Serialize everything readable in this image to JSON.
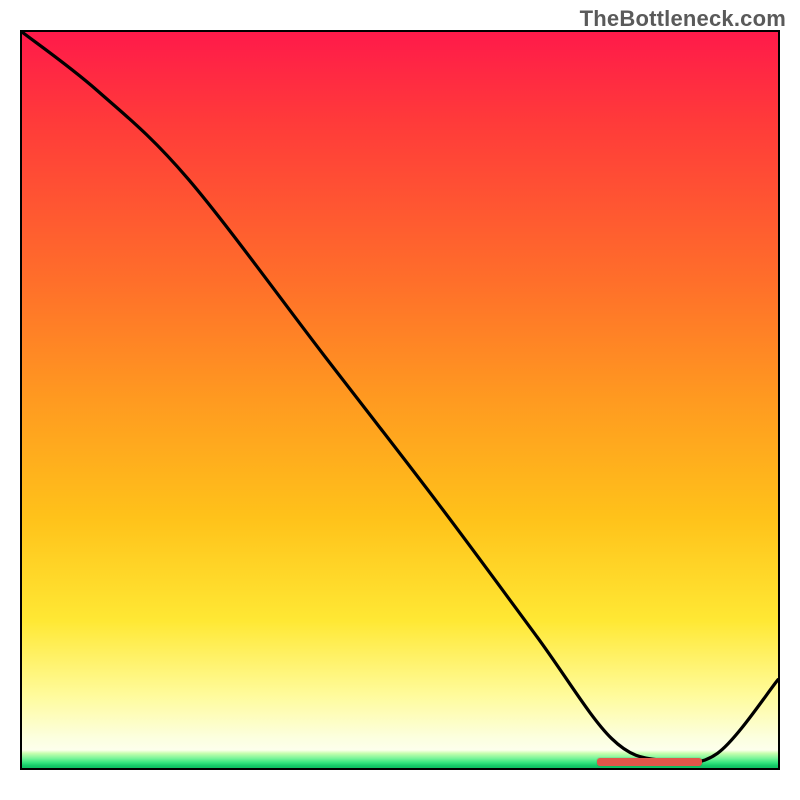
{
  "watermark": "TheBottleneck.com",
  "chart_data": {
    "type": "line",
    "title": "",
    "xlabel": "",
    "ylabel": "",
    "xlim": [
      0,
      100
    ],
    "ylim": [
      0,
      100
    ],
    "grid": false,
    "series": [
      {
        "name": "bottleneck-curve",
        "x": [
          0,
          10,
          22,
          40,
          55,
          68,
          78,
          85,
          92,
          100
        ],
        "y": [
          100,
          92,
          80,
          56,
          36,
          18,
          4,
          1,
          2,
          12
        ]
      }
    ],
    "valley_marker": {
      "x_start": 76,
      "x_end": 90
    },
    "background_gradient": {
      "stops": [
        {
          "pos": 0.0,
          "color": "#ff1a4a"
        },
        {
          "pos": 0.12,
          "color": "#ff3a3a"
        },
        {
          "pos": 0.34,
          "color": "#ff6f2a"
        },
        {
          "pos": 0.5,
          "color": "#ff9a20"
        },
        {
          "pos": 0.66,
          "color": "#ffc21a"
        },
        {
          "pos": 0.8,
          "color": "#ffe834"
        },
        {
          "pos": 0.9,
          "color": "#fffb9a"
        },
        {
          "pos": 0.96,
          "color": "#fcffe0"
        },
        {
          "pos": 1.0,
          "color": "#ffffff"
        }
      ],
      "green_band": [
        "#c9ffb0",
        "#7cf59a",
        "#35e57e",
        "#13c968",
        "#11bf63"
      ]
    }
  }
}
